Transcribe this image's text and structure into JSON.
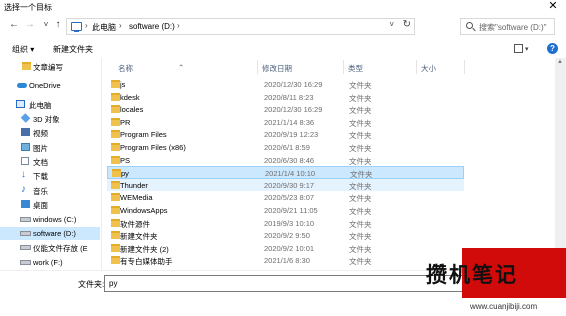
{
  "window": {
    "title": "选择一个目标",
    "close_glyph": "✕"
  },
  "nav": {
    "back_glyph": "←",
    "forward_glyph": "→",
    "recent_glyph": "˅",
    "up_glyph": "↑",
    "breadcrumbs": [
      "此电脑",
      "software (D:)"
    ],
    "breadcrumb_sep": "›",
    "dropdown_glyph": "˅",
    "refresh_glyph": "↻",
    "search_placeholder": "搜索\"software (D:)\""
  },
  "toolbar": {
    "organize": "组织 ▾",
    "new_folder": "新建文件夹",
    "view_caret": "▾",
    "help": "?"
  },
  "sidebar": [
    {
      "label": "文章编写",
      "icon": "folder-icon"
    },
    {
      "label": "OneDrive",
      "icon": "cloud-icon"
    },
    {
      "label": "此电脑",
      "icon": "pc-icon"
    },
    {
      "label": "3D 对象",
      "icon": "cube-icon"
    },
    {
      "label": "视频",
      "icon": "video-icon"
    },
    {
      "label": "图片",
      "icon": "image-icon"
    },
    {
      "label": "文档",
      "icon": "document-icon"
    },
    {
      "label": "下载",
      "icon": "download-icon"
    },
    {
      "label": "音乐",
      "icon": "music-icon"
    },
    {
      "label": "桌面",
      "icon": "desktop-icon"
    },
    {
      "label": "windows (C:)",
      "icon": "drive-icon"
    },
    {
      "label": "software (D:)",
      "icon": "drive-icon",
      "selected": true
    },
    {
      "label": "仪能文件存放 (E",
      "icon": "drive-icon"
    },
    {
      "label": "work (F:)",
      "icon": "drive-icon"
    }
  ],
  "columns": {
    "name": "名称",
    "date": "修改日期",
    "type": "类型",
    "size": "大小",
    "sort_glyph": "⌃"
  },
  "files": [
    {
      "name": "js",
      "date": "2020/12/30 16:29",
      "type": "文件夹"
    },
    {
      "name": "kdesk",
      "date": "2020/8/11 8:23",
      "type": "文件夹"
    },
    {
      "name": "locales",
      "date": "2020/12/30 16:29",
      "type": "文件夹"
    },
    {
      "name": "PR",
      "date": "2021/1/14 8:36",
      "type": "文件夹"
    },
    {
      "name": "Program Files",
      "date": "2020/9/19 12:23",
      "type": "文件夹"
    },
    {
      "name": "Program Files (x86)",
      "date": "2020/6/1 8:59",
      "type": "文件夹"
    },
    {
      "name": "PS",
      "date": "2020/6/30 8:46",
      "type": "文件夹"
    },
    {
      "name": "py",
      "date": "2021/1/4 10:10",
      "type": "文件夹",
      "selected": true
    },
    {
      "name": "Thunder",
      "date": "2020/9/30 9:17",
      "type": "文件夹",
      "hover": true
    },
    {
      "name": "WEMedia",
      "date": "2020/5/23 8:07",
      "type": "文件夹"
    },
    {
      "name": "WindowsApps",
      "date": "2020/9/21 11:05",
      "type": "文件夹"
    },
    {
      "name": "软件源件",
      "date": "2019/9/3 10:10",
      "type": "文件夹"
    },
    {
      "name": "新建文件夹",
      "date": "2020/9/2 9:50",
      "type": "文件夹"
    },
    {
      "name": "新建文件夹 (2)",
      "date": "2020/9/2 10:01",
      "type": "文件夹"
    },
    {
      "name": "有专白媒体助手",
      "date": "2021/1/6 8:30",
      "type": "文件夹"
    }
  ],
  "footer": {
    "filename_label": "文件夹:",
    "filename_value": "py"
  },
  "watermark": {
    "text": "攒机笔记",
    "url": "www.cuanjibiji.com"
  },
  "colors": {
    "accent": "#1e6fd0",
    "selection": "#cce8ff",
    "hover": "#e5f3ff",
    "folder": "#f0c24d",
    "watermark_red": "#d10a0a"
  }
}
